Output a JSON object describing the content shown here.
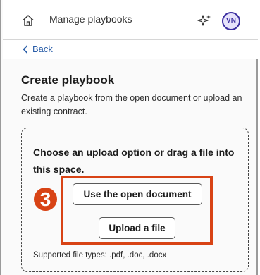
{
  "header": {
    "title": "Manage playbooks",
    "home_icon": "home-icon",
    "sparkle_icon": "sparkle-icon",
    "avatar_initials": "VN",
    "avatar_color": "#3b2ea0"
  },
  "nav": {
    "back_label": "Back",
    "back_icon": "chevron-left-icon"
  },
  "main": {
    "title": "Create playbook",
    "description": "Create a playbook from the open document or upload an existing contract."
  },
  "dropzone": {
    "heading": "Choose an upload option or drag a file into this space.",
    "open_document_button": "Use the open document",
    "upload_button": "Upload a file",
    "supported_types": "Supported file types: .pdf, .doc, .docx"
  },
  "annotation": {
    "step_number": "3",
    "color": "#d84315"
  }
}
